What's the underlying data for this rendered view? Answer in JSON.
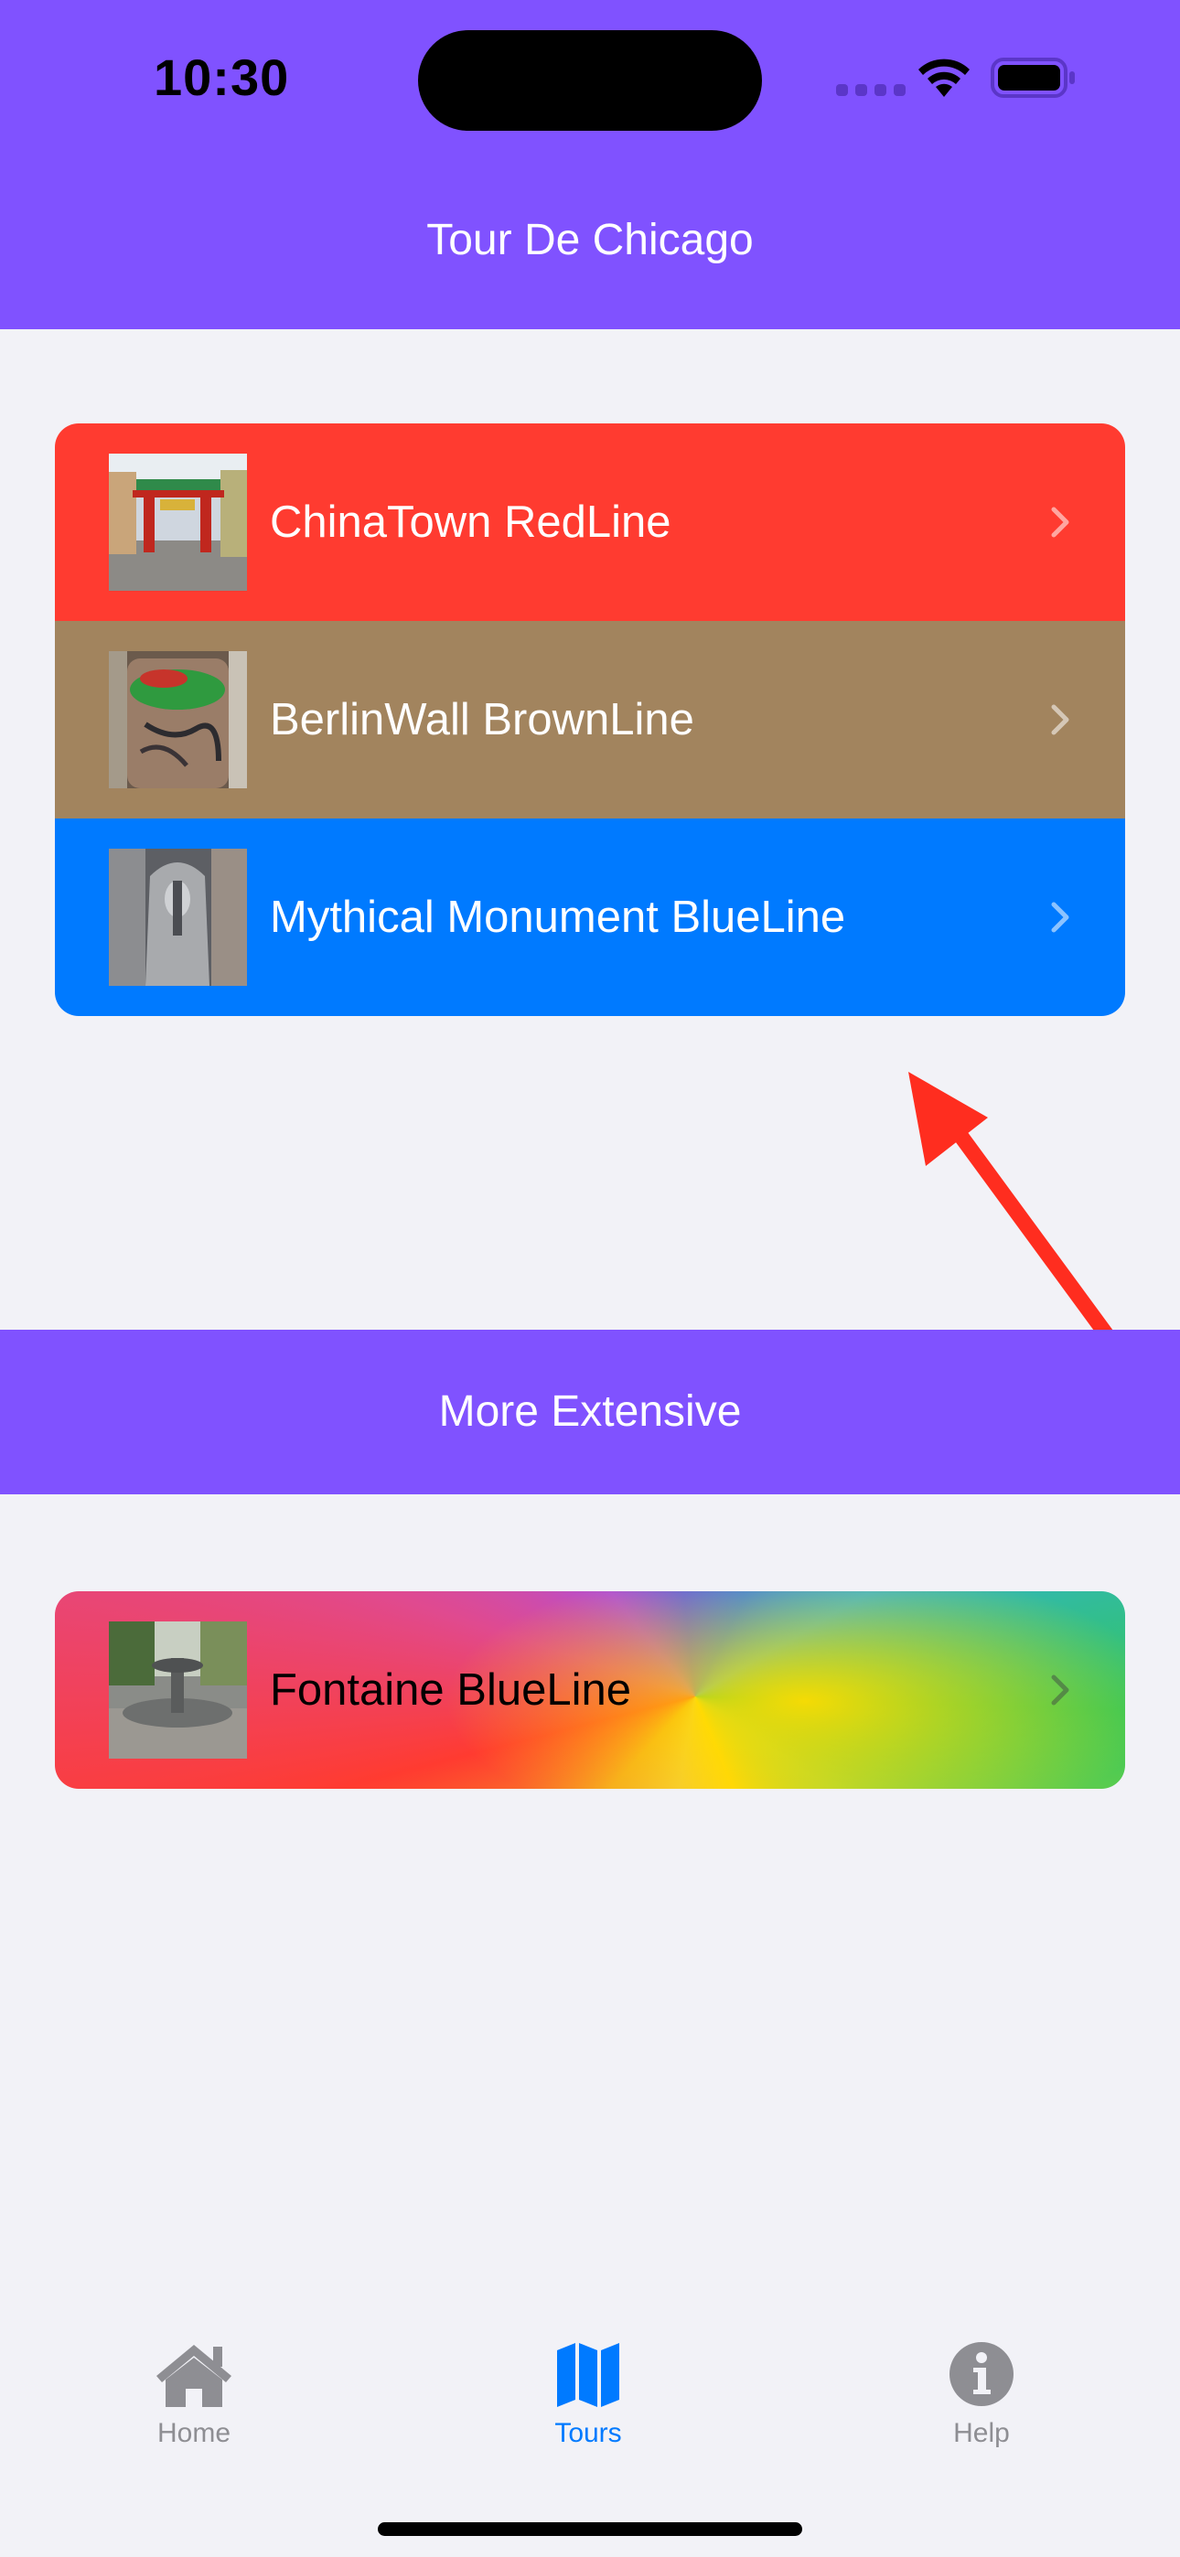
{
  "status_bar": {
    "time": "10:30",
    "background_color": "#8052ff"
  },
  "nav": {
    "title": "Tour De Chicago"
  },
  "tours": [
    {
      "label": "ChinaTown RedLine",
      "color": "#ff3b30",
      "thumbnail": "chinatown-gate-photo"
    },
    {
      "label": "BerlinWall BrownLine",
      "color": "#a2845e",
      "thumbnail": "berlin-wall-segment-photo"
    },
    {
      "label": "Mythical Monument BlueLine",
      "color": "#007aff",
      "thumbnail": "picasso-sculpture-photo"
    }
  ],
  "section": {
    "title": "More Extensive"
  },
  "extensive_tours": [
    {
      "label": "Fontaine BlueLine",
      "color": "rainbow-gradient",
      "thumbnail": "fountain-photo"
    }
  ],
  "tab_bar": {
    "items": [
      {
        "label": "Home",
        "icon": "house-icon",
        "selected": false
      },
      {
        "label": "Tours",
        "icon": "map-icon",
        "selected": true
      },
      {
        "label": "Help",
        "icon": "info-icon",
        "selected": false
      }
    ],
    "active_color": "#007aff",
    "inactive_color": "#8e8e93"
  },
  "annotation": {
    "arrow_color": "#ff2d1f"
  }
}
